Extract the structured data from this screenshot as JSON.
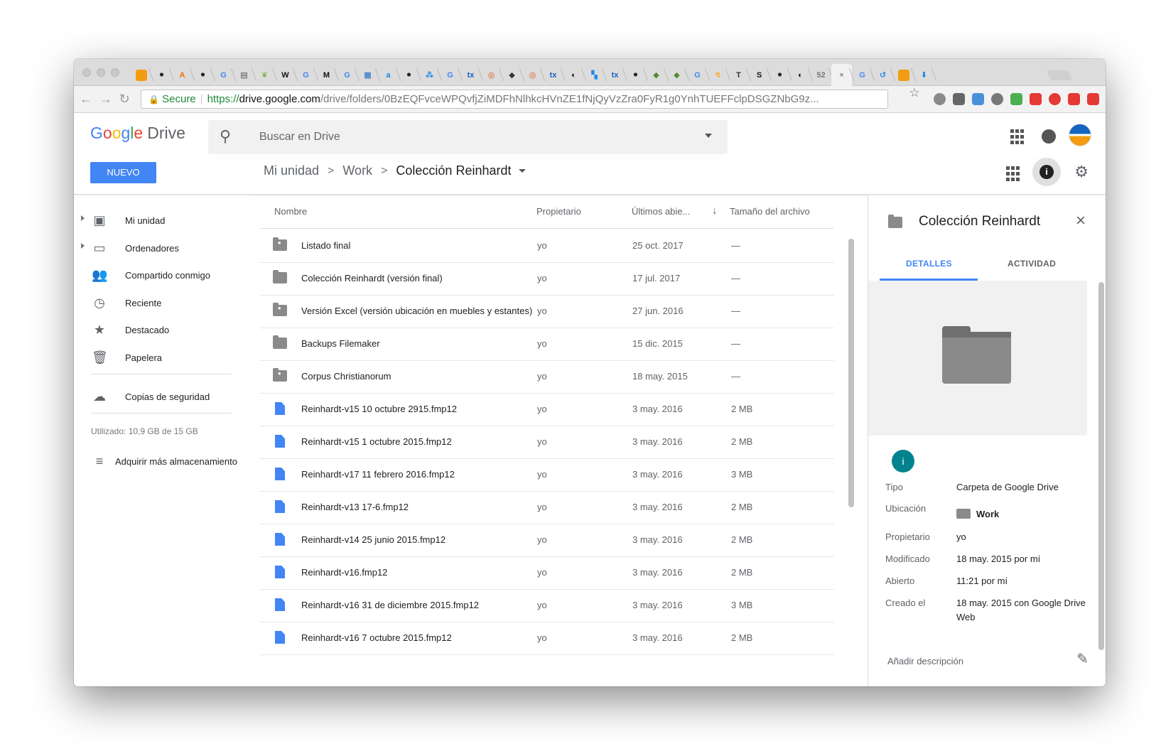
{
  "browser": {
    "tabs": [
      {
        "glyph": "",
        "color": "#f39c12"
      },
      {
        "glyph": "⚫",
        "color": "#222"
      },
      {
        "glyph": "A",
        "color": "#e8710a"
      },
      {
        "glyph": "⚫",
        "color": "#222"
      },
      {
        "glyph": "G",
        "color": "#4285f4"
      },
      {
        "glyph": "▤",
        "color": "#555"
      },
      {
        "glyph": "❦",
        "color": "#7cb342"
      },
      {
        "glyph": "W",
        "color": "#111"
      },
      {
        "glyph": "G",
        "color": "#4285f4"
      },
      {
        "glyph": "M",
        "color": "#111"
      },
      {
        "glyph": "G",
        "color": "#4285f4"
      },
      {
        "glyph": "▦",
        "color": "#1565c0"
      },
      {
        "glyph": "a",
        "color": "#1e88e5"
      },
      {
        "glyph": "⚫",
        "color": "#222"
      },
      {
        "glyph": "⁂",
        "color": "#1e88e5"
      },
      {
        "glyph": "G",
        "color": "#4285f4"
      },
      {
        "glyph": "tx",
        "color": "#1565c0"
      },
      {
        "glyph": "◎",
        "color": "#e64a19"
      },
      {
        "glyph": "◆",
        "color": "#333"
      },
      {
        "glyph": "◎",
        "color": "#e64a19"
      },
      {
        "glyph": "tx",
        "color": "#1565c0"
      },
      {
        "glyph": "◐",
        "color": "#111"
      },
      {
        "glyph": "▚",
        "color": "#1e88e5"
      },
      {
        "glyph": "tx",
        "color": "#1565c0"
      },
      {
        "glyph": "⚫",
        "color": "#222"
      },
      {
        "glyph": "◆",
        "color": "#558b2f"
      },
      {
        "glyph": "◆",
        "color": "#558b2f"
      },
      {
        "glyph": "G",
        "color": "#4285f4"
      },
      {
        "glyph": "↯",
        "color": "#f9a825"
      },
      {
        "glyph": "T",
        "color": "#333"
      },
      {
        "glyph": "S",
        "color": "#111"
      },
      {
        "glyph": "⚫",
        "color": "#222"
      },
      {
        "glyph": "◐",
        "color": "#111"
      },
      {
        "glyph": "52",
        "color": "#777"
      },
      {
        "glyph": "×",
        "color": "#555"
      },
      {
        "glyph": "G",
        "color": "#4285f4"
      },
      {
        "glyph": "↺",
        "color": "#1e88e5"
      },
      {
        "glyph": "",
        "color": "#f39c12"
      },
      {
        "glyph": "⬇",
        "color": "#1e88e5"
      }
    ],
    "secure_label": "Secure",
    "url_scheme": "https://",
    "url_host": "drive.google.com",
    "url_path": "/drive/folders/0BzEQFvceWPQvfjZiMDFhNlhkcHVnZE1fNjQyVzZra0FyR1g0YnhTUEFFclpDSGZNbG9z...",
    "ext_colors": [
      "#8a8a8a",
      "#666",
      "#4a90d9",
      "#777",
      "#4caf50",
      "#e53935",
      "#e53935",
      "#e53935",
      "#e53935",
      "#26a69a",
      "#999",
      "#bbb",
      "#ccc"
    ]
  },
  "drive": {
    "logo_google": [
      "G",
      "o",
      "o",
      "g",
      "l",
      "e"
    ],
    "logo_drive": "Drive",
    "search_placeholder": "Buscar en Drive",
    "new_button": "NUEVO",
    "breadcrumb": {
      "root": "Mi unidad",
      "mid": "Work",
      "current": "Colección Reinhardt",
      "sep": ">"
    },
    "info_icon": "i"
  },
  "nav": {
    "items": [
      {
        "label": "Mi unidad",
        "icon": "drive-icon",
        "glyph": "▣",
        "expandable": true
      },
      {
        "label": "Ordenadores",
        "icon": "computers-icon",
        "glyph": "▭",
        "expandable": true
      },
      {
        "label": "Compartido conmigo",
        "icon": "shared-icon",
        "glyph": "👥",
        "expandable": false
      },
      {
        "label": "Reciente",
        "icon": "clock-icon",
        "glyph": "◷",
        "expandable": false
      },
      {
        "label": "Destacado",
        "icon": "star-icon",
        "glyph": "★",
        "expandable": false
      },
      {
        "label": "Papelera",
        "icon": "trash-icon",
        "glyph": "🗑",
        "expandable": false
      }
    ],
    "backups": {
      "label": "Copias de seguridad",
      "glyph": "☁"
    },
    "storage": "Utilizado: 10,9 GB de 15 GB",
    "buy": {
      "label": "Adquirir más almacenamiento",
      "glyph": "≡"
    }
  },
  "list": {
    "headers": {
      "name": "Nombre",
      "owner": "Propietario",
      "opened": "Últimos abie...",
      "sort_arrow": "↓",
      "size": "Tamaño del archivo"
    },
    "rows": [
      {
        "type": "shared-folder",
        "name": "Listado final",
        "owner": "yo",
        "date": "25 oct. 2017",
        "size": "—"
      },
      {
        "type": "folder",
        "name": "Colección Reinhardt (versión final)",
        "owner": "yo",
        "date": "17 jul. 2017",
        "size": "—"
      },
      {
        "type": "shared-folder",
        "name": "Versión Excel (versión ubicación en muebles y estantes)",
        "owner": "yo",
        "date": "27 jun. 2016",
        "size": "—"
      },
      {
        "type": "folder",
        "name": "Backups Filemaker",
        "owner": "yo",
        "date": "15 dic. 2015",
        "size": "—"
      },
      {
        "type": "shared-folder",
        "name": "Corpus Christianorum",
        "owner": "yo",
        "date": "18 may. 2015",
        "size": "—"
      },
      {
        "type": "file",
        "name": "Reinhardt-v15 10 octubre 2915.fmp12",
        "owner": "yo",
        "date": "3 may. 2016",
        "size": "2 MB"
      },
      {
        "type": "file",
        "name": "Reinhardt-v15 1 octubre 2015.fmp12",
        "owner": "yo",
        "date": "3 may. 2016",
        "size": "2 MB"
      },
      {
        "type": "file",
        "name": "Reinhardt-v17 11 febrero 2016.fmp12",
        "owner": "yo",
        "date": "3 may. 2016",
        "size": "3 MB"
      },
      {
        "type": "file",
        "name": "Reinhardt-v13 17-6.fmp12",
        "owner": "yo",
        "date": "3 may. 2016",
        "size": "2 MB"
      },
      {
        "type": "file",
        "name": "Reinhardt-v14 25 junio 2015.fmp12",
        "owner": "yo",
        "date": "3 may. 2016",
        "size": "2 MB"
      },
      {
        "type": "file",
        "name": "Reinhardt-v16.fmp12",
        "owner": "yo",
        "date": "3 may. 2016",
        "size": "2 MB"
      },
      {
        "type": "file",
        "name": "Reinhardt-v16 31 de diciembre 2015.fmp12",
        "owner": "yo",
        "date": "3 may. 2016",
        "size": "3 MB"
      },
      {
        "type": "file",
        "name": "Reinhardt-v16 7 octubre 2015.fmp12",
        "owner": "yo",
        "date": "3 may. 2016",
        "size": "2 MB"
      }
    ]
  },
  "details": {
    "title": "Colección Reinhardt",
    "close": "×",
    "tab_details": "DETALLES",
    "tab_activity": "ACTIVIDAD",
    "info_badge": "i",
    "fields": [
      {
        "label": "Tipo",
        "value": "Carpeta de Google Drive"
      },
      {
        "label": "Ubicación",
        "value": "Work"
      },
      {
        "label": "Propietario",
        "value": "yo"
      },
      {
        "label": "Modificado",
        "value": "18 may. 2015 por mí"
      },
      {
        "label": "Abierto",
        "value": "11:21 por mí"
      },
      {
        "label": "Creado el",
        "value": "18 may. 2015 con Google Drive Web"
      }
    ],
    "add_description": "Añadir descripción",
    "edit_icon": "✎"
  }
}
